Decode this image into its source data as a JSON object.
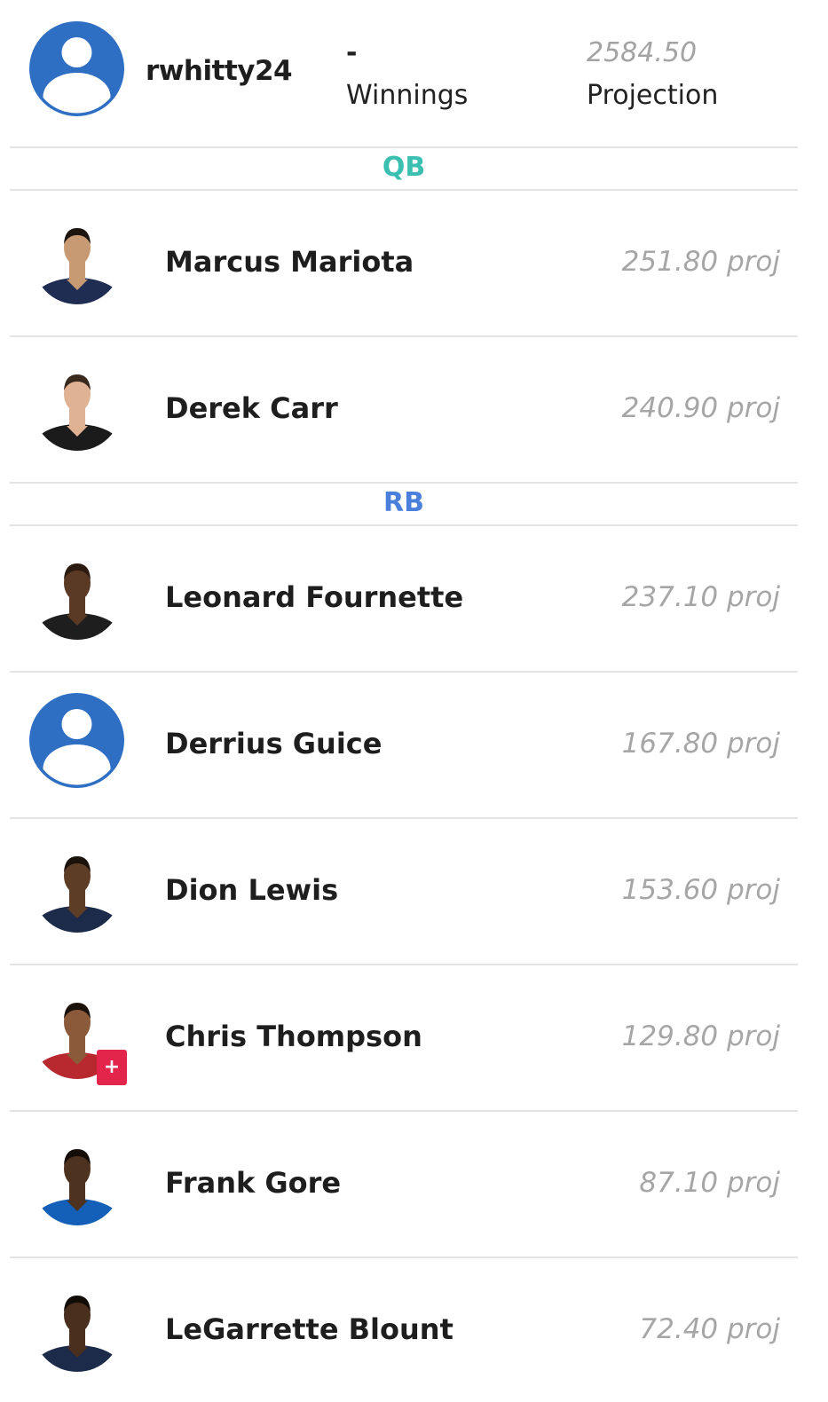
{
  "user": {
    "username": "rwhitty24",
    "avatar_icon": "user-avatar-icon",
    "avatar_color": "#2e6fc3"
  },
  "stats": {
    "winnings": {
      "value": "-",
      "label": "Winnings"
    },
    "projection": {
      "value": "2584.50",
      "label": "Projection"
    }
  },
  "sections": [
    {
      "position": "QB",
      "color": "#3bbfb0",
      "players": [
        {
          "name": "Marcus Mariota",
          "projection": "251.80 proj",
          "jersey_color": "#1f2d52",
          "skin_color": "#c79a74",
          "hair_color": "#1d1410"
        },
        {
          "name": "Derek Carr",
          "projection": "240.90 proj",
          "jersey_color": "#1b1b1b",
          "skin_color": "#e0b294",
          "hair_color": "#3a2a1e"
        }
      ]
    },
    {
      "position": "RB",
      "color": "#4a7fdc",
      "players": [
        {
          "name": "Leonard Fournette",
          "projection": "237.10 proj",
          "jersey_color": "#1e1e1e",
          "skin_color": "#5a3a25",
          "hair_color": "#2a1a10"
        },
        {
          "name": "Derrius Guice",
          "projection": "167.80 proj",
          "generic_avatar": true,
          "icon": "user-avatar-icon"
        },
        {
          "name": "Dion Lewis",
          "projection": "153.60 proj",
          "jersey_color": "#1c2b4a",
          "skin_color": "#5e3d27",
          "hair_color": "#1b120c"
        },
        {
          "name": "Chris Thompson",
          "projection": "129.80 proj",
          "jersey_color": "#b8282f",
          "skin_color": "#8a5a3a",
          "hair_color": "#1b120c",
          "injury_badge": "+"
        },
        {
          "name": "Frank Gore",
          "projection": "87.10 proj",
          "jersey_color": "#1460b8",
          "skin_color": "#4e3220",
          "hair_color": "#150e08"
        },
        {
          "name": "LeGarrette Blount",
          "projection": "72.40 proj",
          "jersey_color": "#1c2b4a",
          "skin_color": "#4a2f1e",
          "hair_color": "#120c07"
        }
      ]
    }
  ]
}
